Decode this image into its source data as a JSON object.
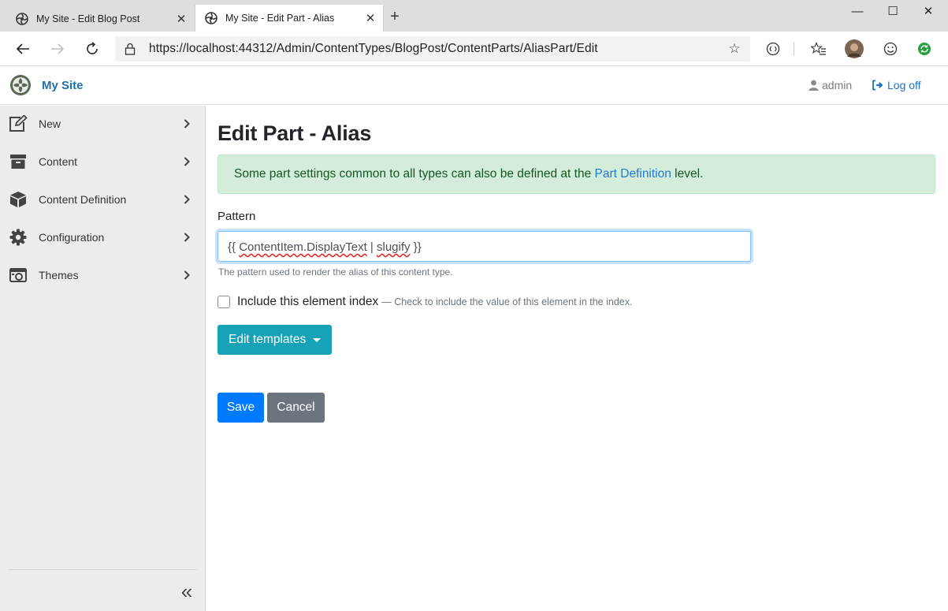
{
  "browser": {
    "tabs": [
      {
        "title": "My Site - Edit Blog Post",
        "active": false
      },
      {
        "title": "My Site - Edit Part - Alias",
        "active": true
      }
    ],
    "tab_close_glyph": "✕",
    "new_tab_glyph": "+",
    "url": "https://localhost:44312/Admin/ContentTypes/BlogPost/ContentParts/AliasPart/Edit",
    "window_controls": {
      "minimize": "—",
      "maximize": "☐",
      "close": "✕"
    }
  },
  "header": {
    "brand": "My Site",
    "user": "admin",
    "logoff": "Log off"
  },
  "sidebar": {
    "items": [
      {
        "label": "New",
        "icon": "edit-icon"
      },
      {
        "label": "Content",
        "icon": "archive-icon"
      },
      {
        "label": "Content Definition",
        "icon": "cube-icon"
      },
      {
        "label": "Configuration",
        "icon": "gear-icon"
      },
      {
        "label": "Themes",
        "icon": "camera-icon"
      }
    ],
    "collapse_glyph": "«"
  },
  "main": {
    "title": "Edit Part - Alias",
    "alert": {
      "prefix": "Some part settings common to all types can also be defined at the ",
      "link": "Part Definition",
      "suffix": " level."
    },
    "pattern": {
      "label": "Pattern",
      "open": "{{ ",
      "word1": "ContentItem.DisplayText",
      "middle": " | ",
      "word2": "slugify",
      "close": " }}",
      "value": "{{ ContentItem.DisplayText | slugify }}",
      "help": "The pattern used to render the alias of this content type."
    },
    "index": {
      "label": "Include this element index",
      "hint": "— Check to include the value of this element in the index.",
      "checked": false
    },
    "edit_templates_label": "Edit templates",
    "save_label": "Save",
    "cancel_label": "Cancel"
  },
  "colors": {
    "primary": "#007bff",
    "info": "#17a2b8",
    "secondary": "#6c757d",
    "success_bg": "#d4edda",
    "brand": "#1f6fa8",
    "link": "#1a73c8"
  }
}
